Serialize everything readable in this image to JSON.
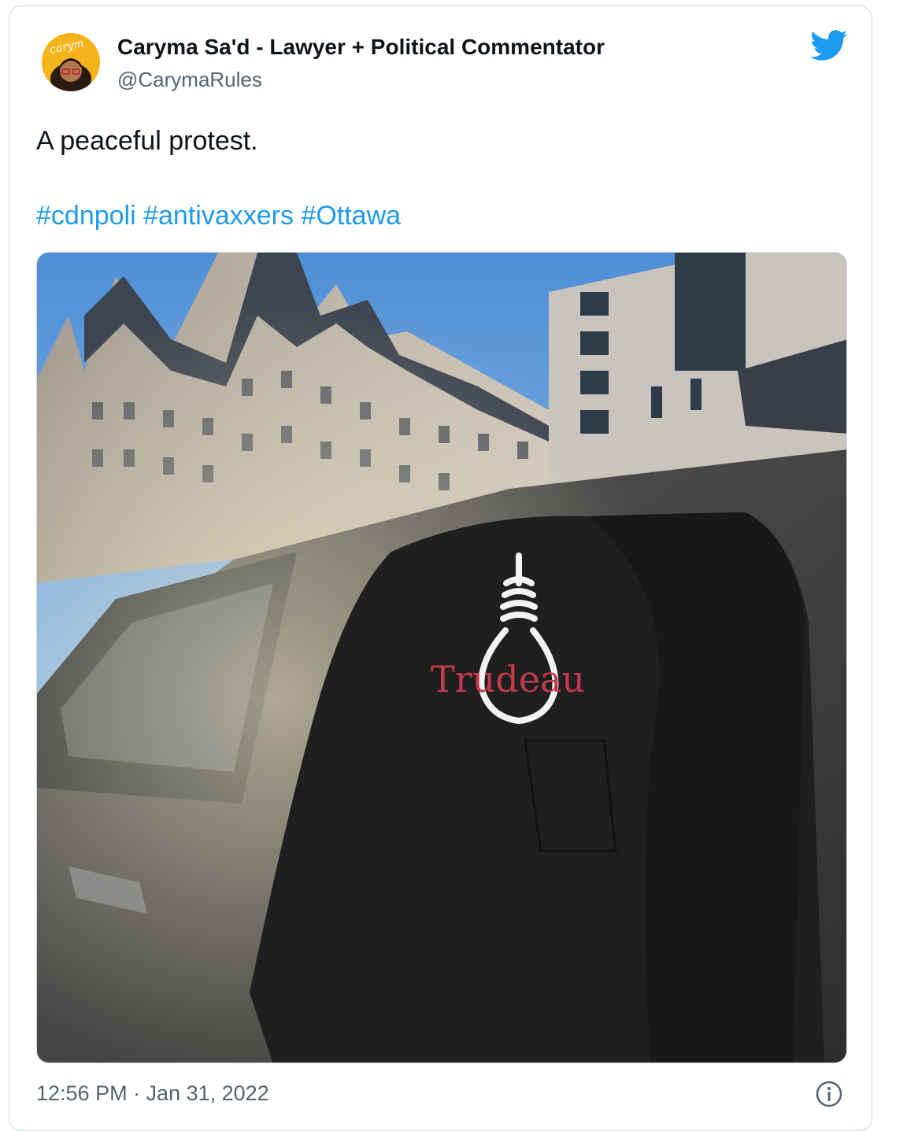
{
  "author": {
    "display_name": "Caryma Sa'd - Lawyer + Political Commentator",
    "handle": "@CarymaRules",
    "avatar_text": "carymarules"
  },
  "tweet": {
    "text": "A peaceful protest.",
    "hashtags": [
      "#cdnpoli",
      "#antivaxxers",
      "#Ottawa"
    ],
    "timestamp": "12:56 PM · Jan 31, 2022"
  },
  "photo": {
    "sweater_text": "Trudeau"
  },
  "icons": {
    "brand": "twitter-bird-icon",
    "info": "info-icon"
  },
  "colors": {
    "link": "#1d9bf0",
    "twitter_blue": "#1d9bf0",
    "secondary_text": "#536471",
    "sweater_text": "#c43a4a"
  }
}
